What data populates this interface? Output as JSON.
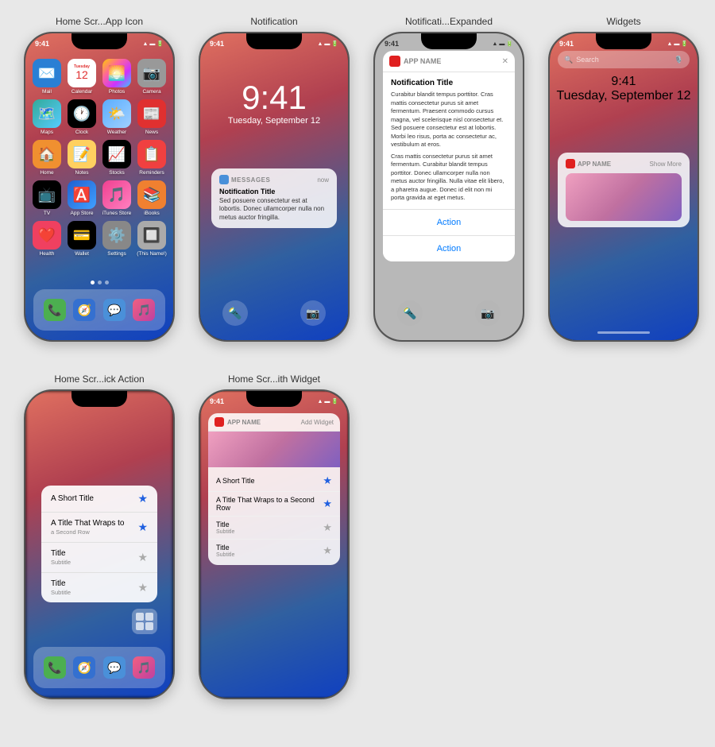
{
  "labels": {
    "phone1": "Home Scr...App Icon",
    "phone2": "Notification",
    "phone3": "Notificati...Expanded",
    "phone4": "Widgets",
    "phone5": "Home Scr...ick Action",
    "phone6": "Home Scr...ith Widget"
  },
  "statusBar": {
    "time": "9:41",
    "icons": "▲ ◼ 🔋"
  },
  "phone1": {
    "apps": [
      {
        "name": "Mail",
        "color": "#2a7fd4",
        "emoji": "✉️"
      },
      {
        "name": "Calendar",
        "color": "#e8e8e8",
        "emoji": "📅"
      },
      {
        "name": "Photos",
        "color": "#e8e8e8",
        "emoji": "🌅"
      },
      {
        "name": "Camera",
        "color": "#999",
        "emoji": "📷"
      },
      {
        "name": "Maps",
        "color": "#e8e8e8",
        "emoji": "🗺️"
      },
      {
        "name": "Clock",
        "color": "#000",
        "emoji": "🕐"
      },
      {
        "name": "Weather",
        "color": "#5aadff",
        "emoji": "🌤️"
      },
      {
        "name": "News",
        "color": "#e03030",
        "emoji": "📰"
      },
      {
        "name": "Home",
        "color": "#f09030",
        "emoji": "🏠"
      },
      {
        "name": "Notes",
        "color": "#ffd060",
        "emoji": "📝"
      },
      {
        "name": "Stocks",
        "color": "#000",
        "emoji": "📈"
      },
      {
        "name": "Reminders",
        "color": "#f04040",
        "emoji": "📋"
      },
      {
        "name": "TV",
        "color": "#000",
        "emoji": "📺"
      },
      {
        "name": "App Store",
        "color": "#2060d0",
        "emoji": "🅰️"
      },
      {
        "name": "iTunes Store",
        "color": "#f04090",
        "emoji": "🎵"
      },
      {
        "name": "iBooks",
        "color": "#f08030",
        "emoji": "📚"
      },
      {
        "name": "Health",
        "color": "#f04060",
        "emoji": "❤️"
      },
      {
        "name": "Wallet",
        "color": "#000",
        "emoji": "💳"
      },
      {
        "name": "Settings",
        "color": "#999",
        "emoji": "⚙️"
      },
      {
        "name": "(This Name!)",
        "color": "#aaa",
        "emoji": "🔲"
      }
    ],
    "dock": [
      "Phone",
      "Safari",
      "Messages",
      "Music"
    ]
  },
  "phone2": {
    "time": "9:41",
    "date": "Tuesday, September 12",
    "notification": {
      "appName": "MESSAGES",
      "appColor": "#4a90d9",
      "time": "now",
      "title": "Notification Title",
      "body": "Sed posuere consectetur est at lobortis. Donec ullamcorper nulla non metus auctor fringilla."
    }
  },
  "phone3": {
    "notification": {
      "appName": "APP NAME",
      "appColor": "#e02020",
      "title": "Notification Title",
      "body": "Curabitur blandit tempus porttitor. Cras mattis consectetur purus sit amet fermentum. Praesent commodo cursus magna, vel scelerisque nisl consectetur et. Sed posuere consectetur est at lobortis. Morbi leo risus, porta ac consectetur ac, vestibulum at eros.\n\nCras mattis consectetur purus sit amet fermentum. Curabitur blandit tempus porttitor. Donec ullamcorper nulla non metus auctor fringilla. Nulla vitae elit libero, a pharetra augue. Donec id elit non mi porta gravida at eget metus."
    },
    "actions": [
      "Action",
      "Action"
    ]
  },
  "phone4": {
    "time": "9:41",
    "date": "Tuesday, September 12",
    "search": {
      "placeholder": "Search"
    },
    "widget": {
      "appName": "APP NAME",
      "showMore": "Show More"
    }
  },
  "phone5": {
    "quickActions": [
      {
        "title": "A Short Title",
        "hasSubtitle": false,
        "starred": true
      },
      {
        "title": "A Title That Wraps to",
        "subtitle": "a Second Row",
        "starred": true
      },
      {
        "title": "Title",
        "subtitle": "Subtitle",
        "starred": false
      },
      {
        "title": "Title",
        "subtitle": "Subtitle",
        "starred": false
      }
    ]
  },
  "phone6": {
    "widget": {
      "appName": "APP NAME",
      "addWidget": "Add Widget"
    },
    "items": [
      {
        "title": "A Short Title",
        "starred": true,
        "active": true
      },
      {
        "title": "A Title That Wraps to a Second Row",
        "starred": true,
        "active": true
      },
      {
        "title": "Title",
        "subtitle": "Subtitle",
        "starred": false
      },
      {
        "title": "Title",
        "subtitle": "Subtitle",
        "starred": false
      }
    ]
  }
}
